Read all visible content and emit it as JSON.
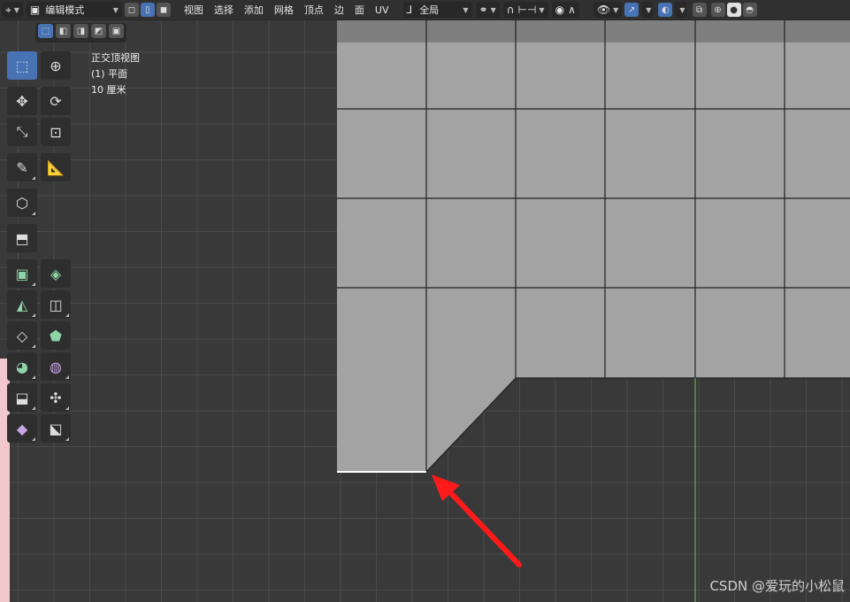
{
  "toolbar": {
    "mode_label": "编辑模式",
    "menus": [
      "视图",
      "选择",
      "添加",
      "网格",
      "顶点",
      "边",
      "面",
      "UV"
    ],
    "transform_orientation": "全局"
  },
  "overlay_info": {
    "view_name": "正交顶视图",
    "object_name": "(1) 平面",
    "scale": "10 厘米"
  },
  "watermark": "CSDN @爱玩的小松鼠",
  "colors": {
    "mesh_face": "#a3a3a3",
    "mesh_edge": "#202020",
    "selected_edge": "#ffffff",
    "y_axis": "#7aa83c",
    "arrow": "#ff1a1a",
    "active_tool": "#4772b3"
  },
  "icons": {
    "select_box": "cursor-icon",
    "cursor": "crosshair-icon",
    "move": "move-icon",
    "rotate": "rotate-icon",
    "scale": "scale-icon",
    "transform": "transform-icon",
    "annotate": "pencil-icon",
    "measure": "ruler-icon"
  }
}
